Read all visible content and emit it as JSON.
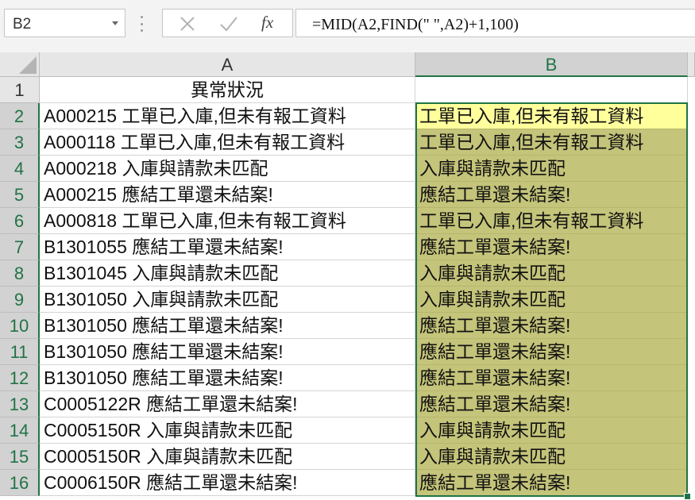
{
  "name_box": {
    "value": "B2"
  },
  "formula_bar": {
    "cancel_icon": "close-icon",
    "enter_icon": "check-icon",
    "fx_label": "fx",
    "formula": "=MID(A2,FIND(\" \",A2)+1,100)"
  },
  "columns": [
    {
      "label": "A",
      "selected": false
    },
    {
      "label": "B",
      "selected": true
    }
  ],
  "rows": [
    {
      "num": "1",
      "a": "異常狀況",
      "b": ""
    },
    {
      "num": "2",
      "a": "A000215 工單已入庫,但未有報工資料",
      "b": "工單已入庫,但未有報工資料"
    },
    {
      "num": "3",
      "a": "A000118 工單已入庫,但未有報工資料",
      "b": "工單已入庫,但未有報工資料"
    },
    {
      "num": "4",
      "a": "A000218 入庫與請款未匹配",
      "b": "入庫與請款未匹配"
    },
    {
      "num": "5",
      "a": "A000215 應結工單還未結案!",
      "b": "應結工單還未結案!"
    },
    {
      "num": "6",
      "a": "A000818 工單已入庫,但未有報工資料",
      "b": "工單已入庫,但未有報工資料"
    },
    {
      "num": "7",
      "a": "B1301055 應結工單還未結案!",
      "b": "應結工單還未結案!"
    },
    {
      "num": "8",
      "a": "B1301045 入庫與請款未匹配",
      "b": "入庫與請款未匹配"
    },
    {
      "num": "9",
      "a": "B1301050 入庫與請款未匹配",
      "b": "入庫與請款未匹配"
    },
    {
      "num": "10",
      "a": "B1301050 應結工單還未結案!",
      "b": "應結工單還未結案!"
    },
    {
      "num": "11",
      "a": "B1301050 應結工單還未結案!",
      "b": "應結工單還未結案!"
    },
    {
      "num": "12",
      "a": "B1301050 應結工單還未結案!",
      "b": "應結工單還未結案!"
    },
    {
      "num": "13",
      "a": "C0005122R 應結工單還未結案!",
      "b": "應結工單還未結案!"
    },
    {
      "num": "14",
      "a": "C0005150R 入庫與請款未匹配",
      "b": "入庫與請款未匹配"
    },
    {
      "num": "15",
      "a": "C0005150R 入庫與請款未匹配",
      "b": "入庫與請款未匹配"
    },
    {
      "num": "16",
      "a": "C0006150R 應結工單還未結案!",
      "b": "應結工單還未結案!"
    }
  ],
  "colors": {
    "selection_border": "#217346",
    "range_fill": "#c4c47a",
    "active_cell_fill": "#ffff9c"
  }
}
